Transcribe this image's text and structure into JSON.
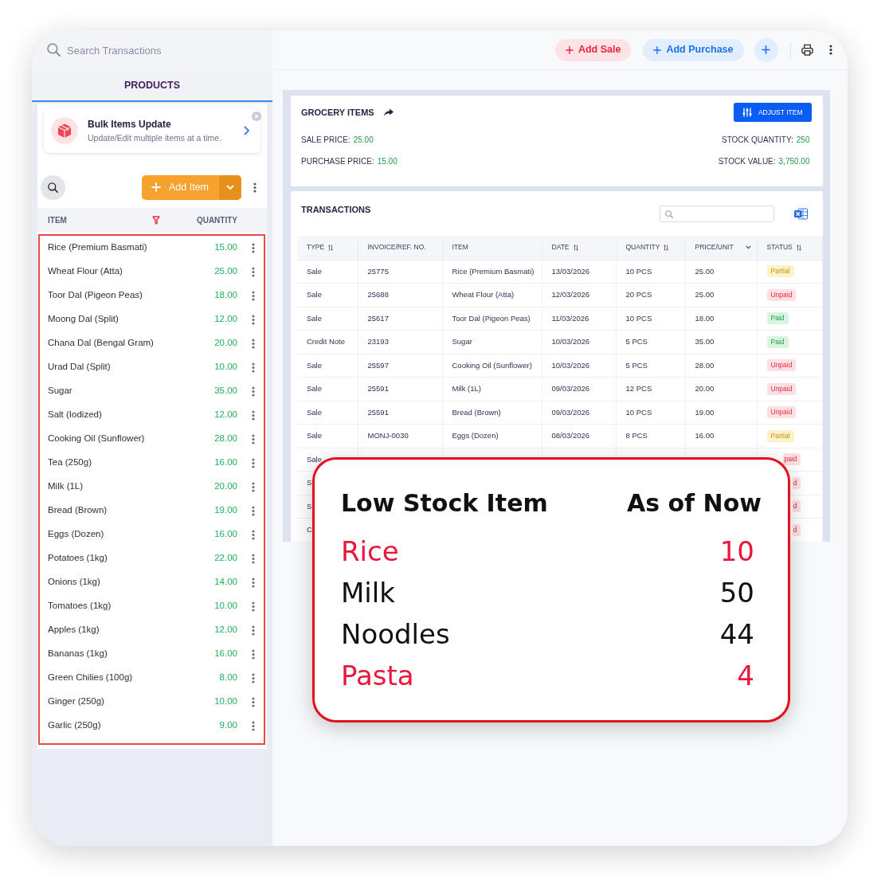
{
  "search": {
    "placeholder": "Search Transactions"
  },
  "actions": [
    {
      "label": "Add Sale",
      "kind": "sale"
    },
    {
      "label": "Add Purchase",
      "kind": "purchase"
    }
  ],
  "sidebar": {
    "tabs": [
      {
        "label": "PRODUCTS",
        "selected": true
      }
    ],
    "promo": {
      "title": "Bulk Items Update",
      "subtitle": "Update/Edit multiple items at a time."
    },
    "add_button": {
      "label": "Add Item"
    },
    "columns": [
      "ITEM",
      "QUANTITY"
    ],
    "items": [
      {
        "name": "Rice (Premium Basmati)",
        "quantity": "15.00"
      },
      {
        "name": "Wheat Flour (Atta)",
        "quantity": "25.00"
      },
      {
        "name": "Toor Dal (Pigeon Peas)",
        "quantity": "18.00"
      },
      {
        "name": "Moong Dal (Split)",
        "quantity": "12.00"
      },
      {
        "name": "Chana Dal (Bengal Gram)",
        "quantity": "20.00"
      },
      {
        "name": "Urad Dal (Split)",
        "quantity": "10.00"
      },
      {
        "name": "Sugar",
        "quantity": "35.00"
      },
      {
        "name": "Salt (Iodized)",
        "quantity": "12.00"
      },
      {
        "name": "Cooking Oil (Sunflower)",
        "quantity": "28.00"
      },
      {
        "name": "Tea (250g)",
        "quantity": "16.00"
      },
      {
        "name": "Milk (1L)",
        "quantity": "20.00"
      },
      {
        "name": "Bread (Brown)",
        "quantity": "19.00"
      },
      {
        "name": "Eggs (Dozen)",
        "quantity": "16.00"
      },
      {
        "name": "Potatoes (1kg)",
        "quantity": "22.00"
      },
      {
        "name": "Onions (1kg)",
        "quantity": "14.00"
      },
      {
        "name": "Tomatoes (1kg)",
        "quantity": "10.00"
      },
      {
        "name": "Apples (1kg)",
        "quantity": "12.00"
      },
      {
        "name": "Bananas (1kg)",
        "quantity": "16.00"
      },
      {
        "name": "Green Chilies (100g)",
        "quantity": "8.00"
      },
      {
        "name": "Ginger (250g)",
        "quantity": "10.00"
      },
      {
        "name": "Garlic (250g)",
        "quantity": "9.00"
      }
    ]
  },
  "item_card": {
    "title": "GROCERY ITEMS",
    "button": "ADJUST ITEM",
    "fields": [
      {
        "label": "SALE PRICE:",
        "value": "25.00"
      },
      {
        "label": "STOCK QUANTITY:",
        "value": "250"
      },
      {
        "label": "PURCHASE PRICE:",
        "value": "15.00"
      },
      {
        "label": "STOCK VALUE:",
        "value": "3,750.00"
      }
    ]
  },
  "transactions": {
    "title": "TRANSACTIONS",
    "columns": [
      {
        "label": "TYPE",
        "kind": "sortable"
      },
      {
        "label": "INVOICE/REF. NO.",
        "kind": "plain"
      },
      {
        "label": "ITEM",
        "kind": "plain"
      },
      {
        "label": "DATE",
        "kind": "sortable"
      },
      {
        "label": "QUANTITY",
        "kind": "sortable"
      },
      {
        "label": "PRICE/UNIT",
        "kind": "dropdown"
      },
      {
        "label": "STATUS",
        "kind": "sortable"
      }
    ],
    "rows": [
      {
        "type": "Sale",
        "invoice": "25775",
        "item": "Rice (Premium Basmati)",
        "date": "13/03/2026",
        "quantity": "10 PCS",
        "price": "25.00",
        "status": {
          "text": "Partial",
          "kind": "partial"
        }
      },
      {
        "type": "Sale",
        "invoice": "25688",
        "item": "Wheat Flour (Atta)",
        "date": "12/03/2026",
        "quantity": "20 PCS",
        "price": "25.00",
        "status": {
          "text": "Unpaid",
          "kind": "unpaid"
        }
      },
      {
        "type": "Sale",
        "invoice": "25617",
        "item": "Toor Dal (Pigeon Peas)",
        "date": "11/03/2026",
        "quantity": "10 PCS",
        "price": "18.00",
        "status": {
          "text": "Paid",
          "kind": "paid"
        }
      },
      {
        "type": "Credit Note",
        "invoice": "23193",
        "item": "Sugar",
        "date": "10/03/2026",
        "quantity": "5 PCS",
        "price": "35.00",
        "status": {
          "text": "Paid",
          "kind": "paid"
        }
      },
      {
        "type": "Sale",
        "invoice": "25597",
        "item": "Cooking Oil (Sunflower)",
        "date": "10/03/2026",
        "quantity": "5 PCS",
        "price": "28.00",
        "status": {
          "text": "Unpaid",
          "kind": "unpaid"
        }
      },
      {
        "type": "Sale",
        "invoice": "25591",
        "item": "Milk (1L)",
        "date": "09/03/2026",
        "quantity": "12 PCS",
        "price": "20.00",
        "status": {
          "text": "Unpaid",
          "kind": "unpaid"
        }
      },
      {
        "type": "Sale",
        "invoice": "25591",
        "item": "Bread (Brown)",
        "date": "09/03/2026",
        "quantity": "10 PCS",
        "price": "19.00",
        "status": {
          "text": "Unpaid",
          "kind": "unpaid"
        }
      },
      {
        "type": "Sale",
        "invoice": "MONJ-0030",
        "item": "Eggs (Dozen)",
        "date": "08/03/2026",
        "quantity": "8 PCS",
        "price": "16.00",
        "status": {
          "text": "Partial",
          "kind": "partial"
        }
      },
      {
        "type": "Sale",
        "status": {
          "text": "paid",
          "kind": "unpaid"
        }
      },
      {
        "type": "S",
        "status": {
          "text": "d",
          "kind": "unpaid"
        }
      },
      {
        "type": "S",
        "status": {
          "text": "d",
          "kind": "unpaid"
        }
      },
      {
        "type": "C",
        "status": {
          "text": "d",
          "kind": "unpaid"
        }
      }
    ]
  },
  "low_stock": {
    "title": "Low Stock Item",
    "subtitle": "As of Now",
    "items": [
      {
        "name": "Rice",
        "count": "10",
        "alert": true
      },
      {
        "name": "Milk",
        "count": "50",
        "alert": false
      },
      {
        "name": "Noodles",
        "count": "44",
        "alert": false
      },
      {
        "name": "Pasta",
        "count": "4",
        "alert": true
      }
    ]
  }
}
